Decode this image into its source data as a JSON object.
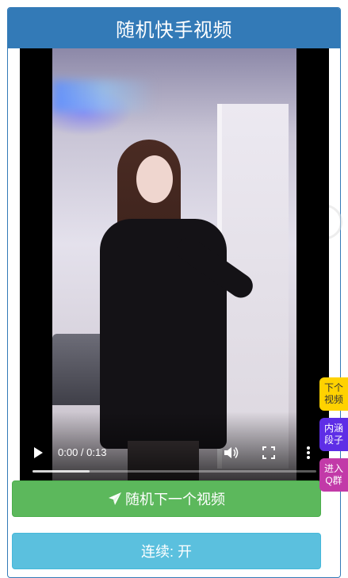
{
  "header": {
    "title": "随机快手视频"
  },
  "video": {
    "time_display": "0:00 / 0:13",
    "progress_fraction": 0.2
  },
  "buttons": {
    "next_label": "随机下一个视频",
    "loop_label": "连续: 开"
  },
  "float_tags": [
    {
      "line1": "下个",
      "line2": "视频"
    },
    {
      "line1": "内涵",
      "line2": "段子"
    },
    {
      "line1": "进入",
      "line2": "Q群"
    }
  ],
  "icons": {
    "play": "play-icon",
    "volume": "volume-icon",
    "fullscreen": "fullscreen-icon",
    "more": "more-vert-icon",
    "send": "paper-plane-icon"
  },
  "colors": {
    "header": "#337ab7",
    "next_button": "#5cb85c",
    "loop_button": "#5bc0de",
    "tag_next": "#ffd200",
    "tag_joke": "#5e2ee6",
    "tag_group": "#c23aa8"
  }
}
